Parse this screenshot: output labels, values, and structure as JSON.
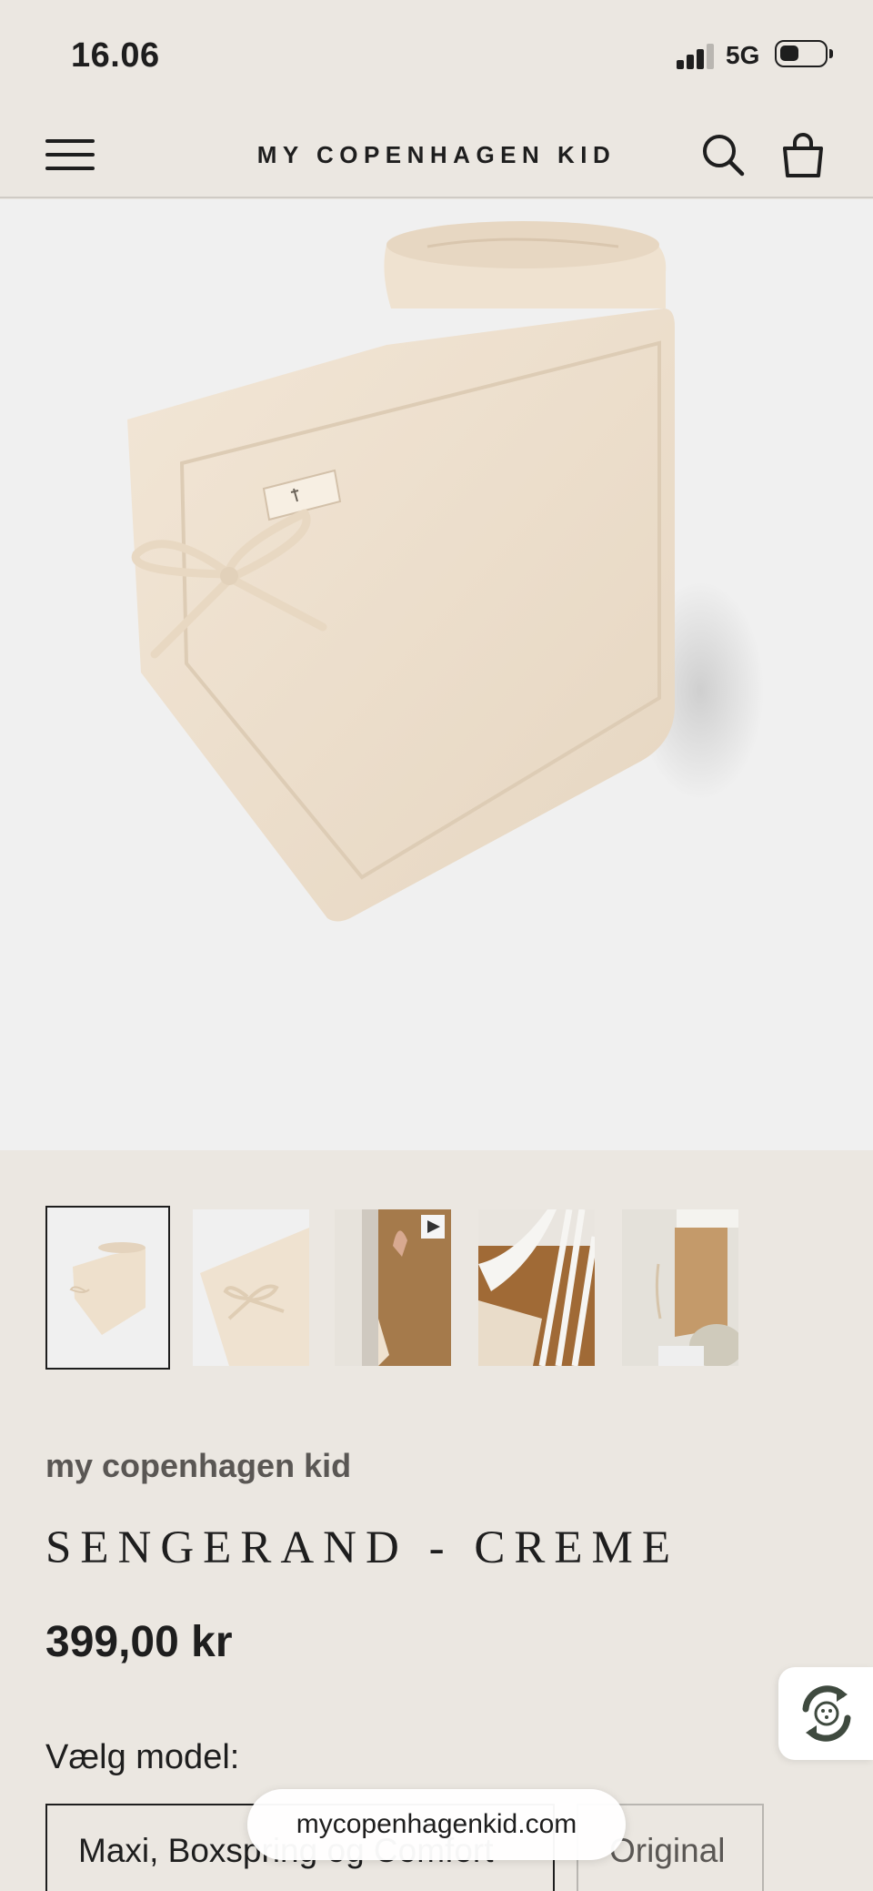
{
  "status_bar": {
    "time": "16.06",
    "network": "5G"
  },
  "header": {
    "logo": "MY COPENHAGEN KID"
  },
  "gallery": {
    "thumbnails": [
      {
        "name": "thumb-rolled-bumper",
        "selected": true
      },
      {
        "name": "thumb-bow-detail",
        "selected": false
      },
      {
        "name": "thumb-video-crib",
        "selected": false,
        "has_video": true
      },
      {
        "name": "thumb-white-crib",
        "selected": false
      },
      {
        "name": "thumb-room",
        "selected": false
      }
    ]
  },
  "product": {
    "brand": "my copenhagen kid",
    "title": "SENGERAND - CREME",
    "price": "399,00 kr",
    "model_label": "Vælg model:",
    "model_options": [
      {
        "label": "Maxi, Boxspring og Comfort",
        "selected": true
      },
      {
        "label": "Original",
        "selected": false
      }
    ]
  },
  "browser": {
    "url": "mycopenhagenkid.com"
  },
  "colors": {
    "background": "#ebe7e1",
    "hero_bg": "#f0f0f0",
    "product": "#efe3d2",
    "text": "#1e1e1e",
    "brand_text": "#5a5754"
  },
  "icons": [
    "menu-icon",
    "search-icon",
    "bag-icon",
    "play-icon",
    "rewards-icon",
    "battery-icon",
    "signal-icon"
  ]
}
